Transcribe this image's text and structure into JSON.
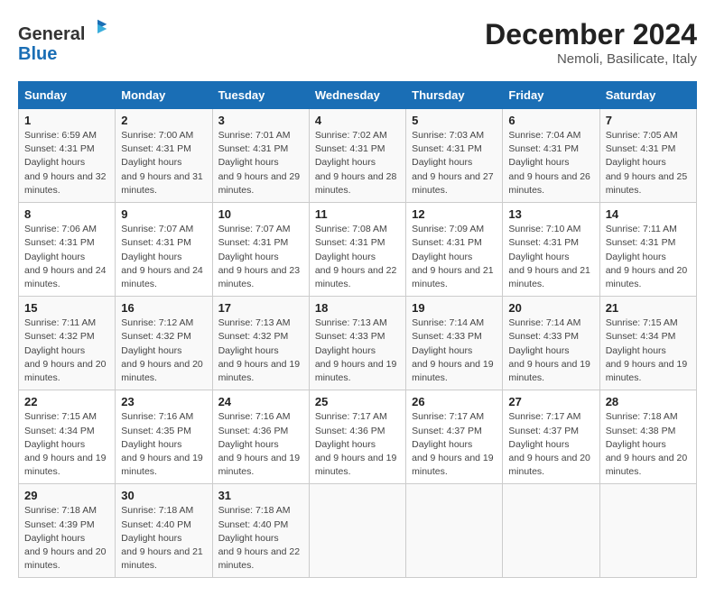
{
  "header": {
    "logo_line1": "General",
    "logo_line2": "Blue",
    "month_title": "December 2024",
    "location": "Nemoli, Basilicate, Italy"
  },
  "weekdays": [
    "Sunday",
    "Monday",
    "Tuesday",
    "Wednesday",
    "Thursday",
    "Friday",
    "Saturday"
  ],
  "weeks": [
    [
      {
        "day": "1",
        "sunrise": "6:59 AM",
        "sunset": "4:31 PM",
        "daylight": "9 hours and 32 minutes."
      },
      {
        "day": "2",
        "sunrise": "7:00 AM",
        "sunset": "4:31 PM",
        "daylight": "9 hours and 31 minutes."
      },
      {
        "day": "3",
        "sunrise": "7:01 AM",
        "sunset": "4:31 PM",
        "daylight": "9 hours and 29 minutes."
      },
      {
        "day": "4",
        "sunrise": "7:02 AM",
        "sunset": "4:31 PM",
        "daylight": "9 hours and 28 minutes."
      },
      {
        "day": "5",
        "sunrise": "7:03 AM",
        "sunset": "4:31 PM",
        "daylight": "9 hours and 27 minutes."
      },
      {
        "day": "6",
        "sunrise": "7:04 AM",
        "sunset": "4:31 PM",
        "daylight": "9 hours and 26 minutes."
      },
      {
        "day": "7",
        "sunrise": "7:05 AM",
        "sunset": "4:31 PM",
        "daylight": "9 hours and 25 minutes."
      }
    ],
    [
      {
        "day": "8",
        "sunrise": "7:06 AM",
        "sunset": "4:31 PM",
        "daylight": "9 hours and 24 minutes."
      },
      {
        "day": "9",
        "sunrise": "7:07 AM",
        "sunset": "4:31 PM",
        "daylight": "9 hours and 24 minutes."
      },
      {
        "day": "10",
        "sunrise": "7:07 AM",
        "sunset": "4:31 PM",
        "daylight": "9 hours and 23 minutes."
      },
      {
        "day": "11",
        "sunrise": "7:08 AM",
        "sunset": "4:31 PM",
        "daylight": "9 hours and 22 minutes."
      },
      {
        "day": "12",
        "sunrise": "7:09 AM",
        "sunset": "4:31 PM",
        "daylight": "9 hours and 21 minutes."
      },
      {
        "day": "13",
        "sunrise": "7:10 AM",
        "sunset": "4:31 PM",
        "daylight": "9 hours and 21 minutes."
      },
      {
        "day": "14",
        "sunrise": "7:11 AM",
        "sunset": "4:31 PM",
        "daylight": "9 hours and 20 minutes."
      }
    ],
    [
      {
        "day": "15",
        "sunrise": "7:11 AM",
        "sunset": "4:32 PM",
        "daylight": "9 hours and 20 minutes."
      },
      {
        "day": "16",
        "sunrise": "7:12 AM",
        "sunset": "4:32 PM",
        "daylight": "9 hours and 20 minutes."
      },
      {
        "day": "17",
        "sunrise": "7:13 AM",
        "sunset": "4:32 PM",
        "daylight": "9 hours and 19 minutes."
      },
      {
        "day": "18",
        "sunrise": "7:13 AM",
        "sunset": "4:33 PM",
        "daylight": "9 hours and 19 minutes."
      },
      {
        "day": "19",
        "sunrise": "7:14 AM",
        "sunset": "4:33 PM",
        "daylight": "9 hours and 19 minutes."
      },
      {
        "day": "20",
        "sunrise": "7:14 AM",
        "sunset": "4:33 PM",
        "daylight": "9 hours and 19 minutes."
      },
      {
        "day": "21",
        "sunrise": "7:15 AM",
        "sunset": "4:34 PM",
        "daylight": "9 hours and 19 minutes."
      }
    ],
    [
      {
        "day": "22",
        "sunrise": "7:15 AM",
        "sunset": "4:34 PM",
        "daylight": "9 hours and 19 minutes."
      },
      {
        "day": "23",
        "sunrise": "7:16 AM",
        "sunset": "4:35 PM",
        "daylight": "9 hours and 19 minutes."
      },
      {
        "day": "24",
        "sunrise": "7:16 AM",
        "sunset": "4:36 PM",
        "daylight": "9 hours and 19 minutes."
      },
      {
        "day": "25",
        "sunrise": "7:17 AM",
        "sunset": "4:36 PM",
        "daylight": "9 hours and 19 minutes."
      },
      {
        "day": "26",
        "sunrise": "7:17 AM",
        "sunset": "4:37 PM",
        "daylight": "9 hours and 19 minutes."
      },
      {
        "day": "27",
        "sunrise": "7:17 AM",
        "sunset": "4:37 PM",
        "daylight": "9 hours and 20 minutes."
      },
      {
        "day": "28",
        "sunrise": "7:18 AM",
        "sunset": "4:38 PM",
        "daylight": "9 hours and 20 minutes."
      }
    ],
    [
      {
        "day": "29",
        "sunrise": "7:18 AM",
        "sunset": "4:39 PM",
        "daylight": "9 hours and 20 minutes."
      },
      {
        "day": "30",
        "sunrise": "7:18 AM",
        "sunset": "4:40 PM",
        "daylight": "9 hours and 21 minutes."
      },
      {
        "day": "31",
        "sunrise": "7:18 AM",
        "sunset": "4:40 PM",
        "daylight": "9 hours and 22 minutes."
      },
      null,
      null,
      null,
      null
    ]
  ]
}
